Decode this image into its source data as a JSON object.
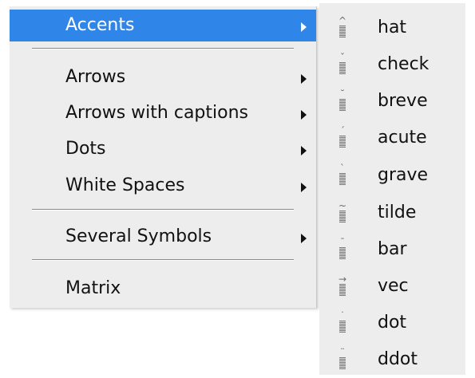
{
  "main_menu": {
    "items": [
      {
        "label": "Accents",
        "submenu": true,
        "selected": true
      },
      {
        "label": "Arrows",
        "submenu": true
      },
      {
        "label": "Arrows with captions",
        "submenu": true
      },
      {
        "label": "Dots",
        "submenu": true
      },
      {
        "label": "White Spaces",
        "submenu": true
      },
      {
        "label": "Several Symbols",
        "submenu": true
      },
      {
        "label": "Matrix",
        "submenu": false
      }
    ]
  },
  "accents_submenu": {
    "items": [
      {
        "label": "hat",
        "mark": "^"
      },
      {
        "label": "check",
        "mark": "ˇ"
      },
      {
        "label": "breve",
        "mark": "˘"
      },
      {
        "label": "acute",
        "mark": "´"
      },
      {
        "label": "grave",
        "mark": "`"
      },
      {
        "label": "tilde",
        "mark": "~"
      },
      {
        "label": "bar",
        "mark": "¯"
      },
      {
        "label": "vec",
        "mark": "→"
      },
      {
        "label": "dot",
        "mark": "˙"
      },
      {
        "label": "ddot",
        "mark": "¨"
      }
    ]
  },
  "colors": {
    "selection": "#2f86e8",
    "menu_background": "#ededed"
  }
}
